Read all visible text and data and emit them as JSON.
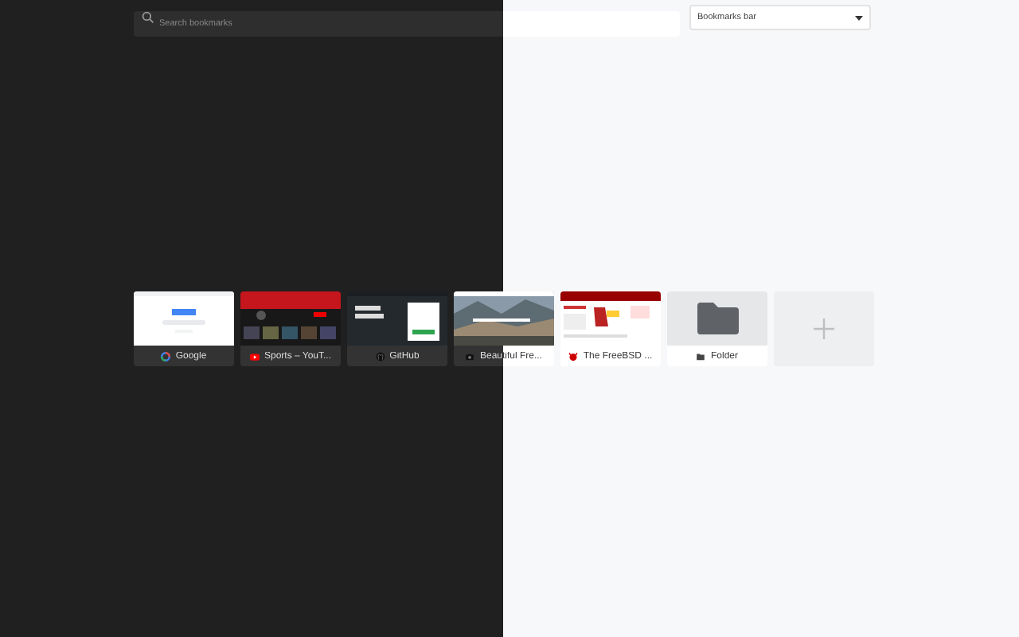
{
  "search": {
    "placeholder": "Search bookmarks"
  },
  "folder_select": {
    "value": "Bookmarks bar"
  },
  "tiles": [
    {
      "kind": "page",
      "title": "Google"
    },
    {
      "kind": "page",
      "title": "Sports – YouT..."
    },
    {
      "kind": "page",
      "title": "GitHub"
    },
    {
      "kind": "page",
      "title": "Beautiful Fre..."
    },
    {
      "kind": "page",
      "title": "The FreeBSD ..."
    },
    {
      "kind": "folder",
      "title": "Folder"
    },
    {
      "kind": "add"
    }
  ]
}
